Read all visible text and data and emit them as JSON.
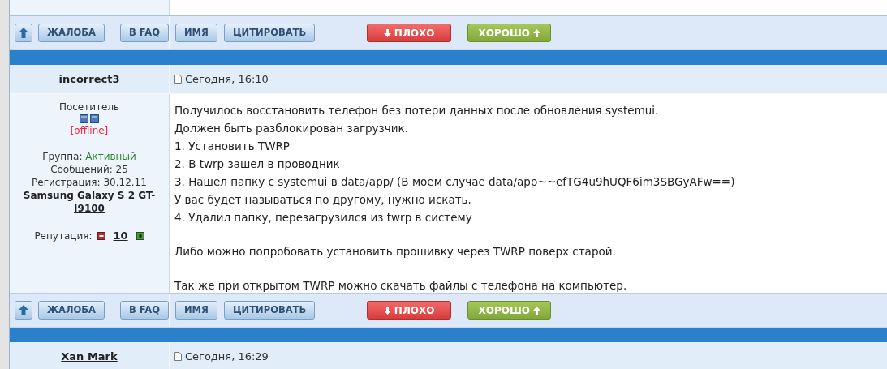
{
  "sections": [
    {
      "kind": "toolbar",
      "buttons": [
        {
          "kind": "up"
        },
        {
          "kind": "plain",
          "label": "ЖАЛОБА"
        },
        {
          "kind": "plain",
          "label": "В FAQ"
        },
        {
          "kind": "plain",
          "label": "ИМЯ"
        },
        {
          "kind": "plain",
          "label": "ЦИТИРОВАТЬ"
        },
        {
          "kind": "bad",
          "label": "ПЛОХО"
        },
        {
          "kind": "good",
          "label": "ХОРОШО"
        }
      ]
    },
    {
      "kind": "post",
      "author": "incorrect3",
      "date": "Сегодня, 16:10",
      "profile": {
        "rank": "Посетитель",
        "status": "[offline]",
        "group_label": "Группа:",
        "group": "Активный",
        "messages": "Сообщений: 25",
        "registered": "Регистрация: 30.12.11",
        "device": "Samsung Galaxy S 2 GT-I9100",
        "reputation_label": "Репутация:",
        "reputation": "10"
      },
      "paragraphs": [
        [
          "Получилось восстановить телефон без потери данных после обновления systemui.",
          "Должен быть разблокирован загрузчик.",
          "1. Установить TWRP",
          "2. В twrp зашел в проводник",
          "3. Нашел папку с systemui в data/app/ (В моем случае data/app~~efTG4u9hUQF6im3SBGyAFw==)",
          "У вас будет называться по другому, нужно искать.",
          "4. Удалил папку, перезагрузился из twrp в систему"
        ],
        [
          "Либо можно попробовать установить прошивку через TWRP поверх старой."
        ],
        [
          "Так же при открытом TWRP можно скачать файлы с телефона на компьютер."
        ]
      ]
    },
    {
      "kind": "toolbar",
      "buttons": [
        {
          "kind": "up"
        },
        {
          "kind": "plain",
          "label": "ЖАЛОБА"
        },
        {
          "kind": "plain",
          "label": "В FAQ"
        },
        {
          "kind": "plain",
          "label": "ИМЯ"
        },
        {
          "kind": "plain",
          "label": "ЦИТИРОВАТЬ"
        },
        {
          "kind": "bad",
          "label": "ПЛОХО"
        },
        {
          "kind": "good",
          "label": "ХОРОШО"
        }
      ]
    },
    {
      "kind": "post",
      "author": "Xan Mark",
      "date": "Сегодня, 16:29"
    }
  ]
}
